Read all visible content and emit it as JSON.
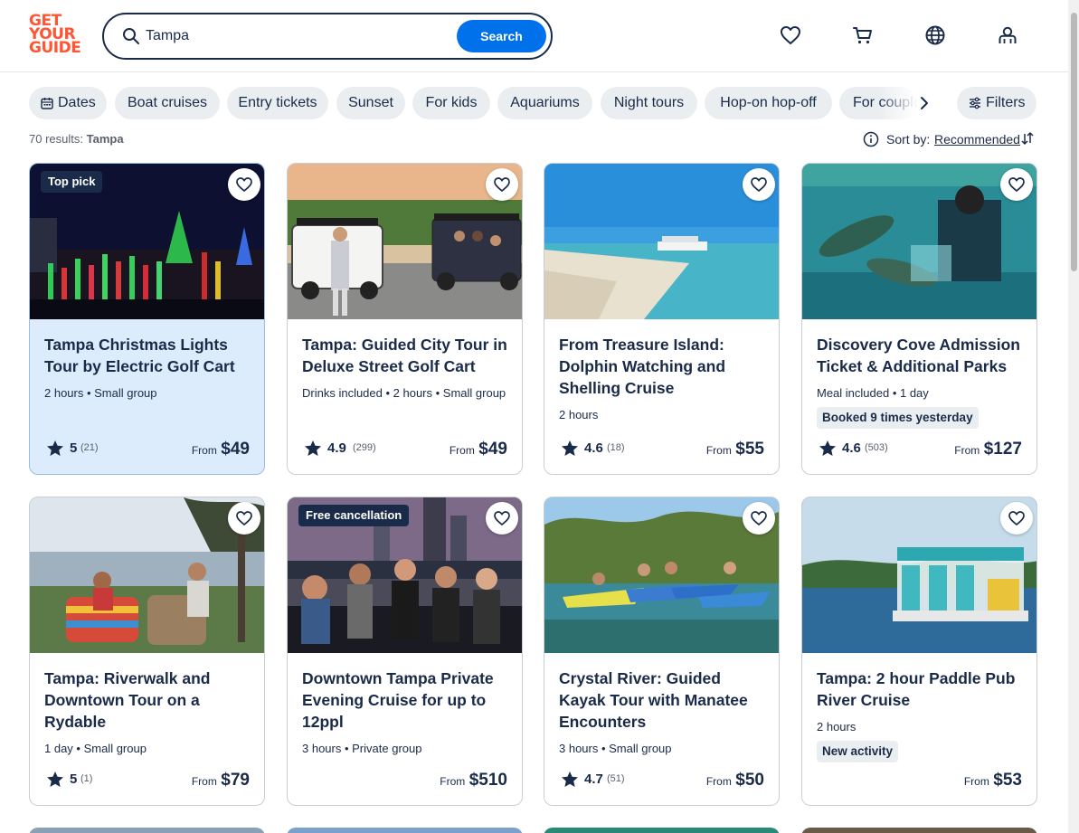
{
  "brand": {
    "logo_lines": [
      "GET",
      "YOUR",
      "GUIDE"
    ],
    "color": "#ff5533"
  },
  "search": {
    "value": "Tampa",
    "button": "Search",
    "accent": "#0071eb"
  },
  "header_icons": [
    "heart-icon",
    "cart-icon",
    "globe-icon",
    "profile-icon"
  ],
  "chips": [
    "Dates",
    "Boat cruises",
    "Entry tickets",
    "Sunset",
    "For kids",
    "Aquariums",
    "Night tours",
    "Hop-on hop-off",
    "For couples"
  ],
  "filters_label": "Filters",
  "results": {
    "count": "70 results:",
    "query": "Tampa"
  },
  "sort": {
    "label": "Sort by:",
    "value": "Recommended"
  },
  "cards": [
    {
      "tag": "Top pick",
      "title": "Tampa Christmas Lights Tour by Electric Golf Cart",
      "meta": "2 hours • Small group",
      "badge": "",
      "rating": "5",
      "reviews": "(21)",
      "from": "From",
      "price": "$49"
    },
    {
      "tag": "",
      "title": "Tampa: Guided City Tour in Deluxe Street Golf Cart",
      "meta": "Drinks included • 2 hours • Small group",
      "badge": "",
      "rating": "4.9",
      "reviews": "(299)",
      "from": "From",
      "price": "$49"
    },
    {
      "tag": "",
      "title": "From Treasure Island: Dolphin Watching and Shelling Cruise",
      "meta": "2 hours",
      "badge": "",
      "rating": "4.6",
      "reviews": "(18)",
      "from": "From",
      "price": "$55"
    },
    {
      "tag": "",
      "title": "Discovery Cove Admission Ticket & Additional Parks",
      "meta": "Meal included • 1 day",
      "badge": "Booked 9 times yesterday",
      "rating": "4.6",
      "reviews": "(503)",
      "from": "From",
      "price": "$127"
    },
    {
      "tag": "",
      "title": "Tampa: Riverwalk and Downtown Tour on a Rydable",
      "meta": "1 day • Small group",
      "badge": "",
      "rating": "5",
      "reviews": "(1)",
      "from": "From",
      "price": "$79"
    },
    {
      "tag": "Free cancellation",
      "title": "Downtown Tampa Private Evening Cruise for up to 12ppl",
      "meta": "3 hours • Private group",
      "badge": "",
      "rating": "",
      "reviews": "",
      "from": "From",
      "price": "$510"
    },
    {
      "tag": "",
      "title": "Crystal River: Guided Kayak Tour with Manatee Encounters",
      "meta": "3 hours • Small group",
      "badge": "",
      "rating": "4.7",
      "reviews": "(51)",
      "from": "From",
      "price": "$50"
    },
    {
      "tag": "",
      "title": "Tampa: 2 hour Paddle Pub River Cruise",
      "meta": "2 hours",
      "badge": "New activity",
      "rating": "",
      "reviews": "",
      "from": "From",
      "price": "$53"
    }
  ]
}
